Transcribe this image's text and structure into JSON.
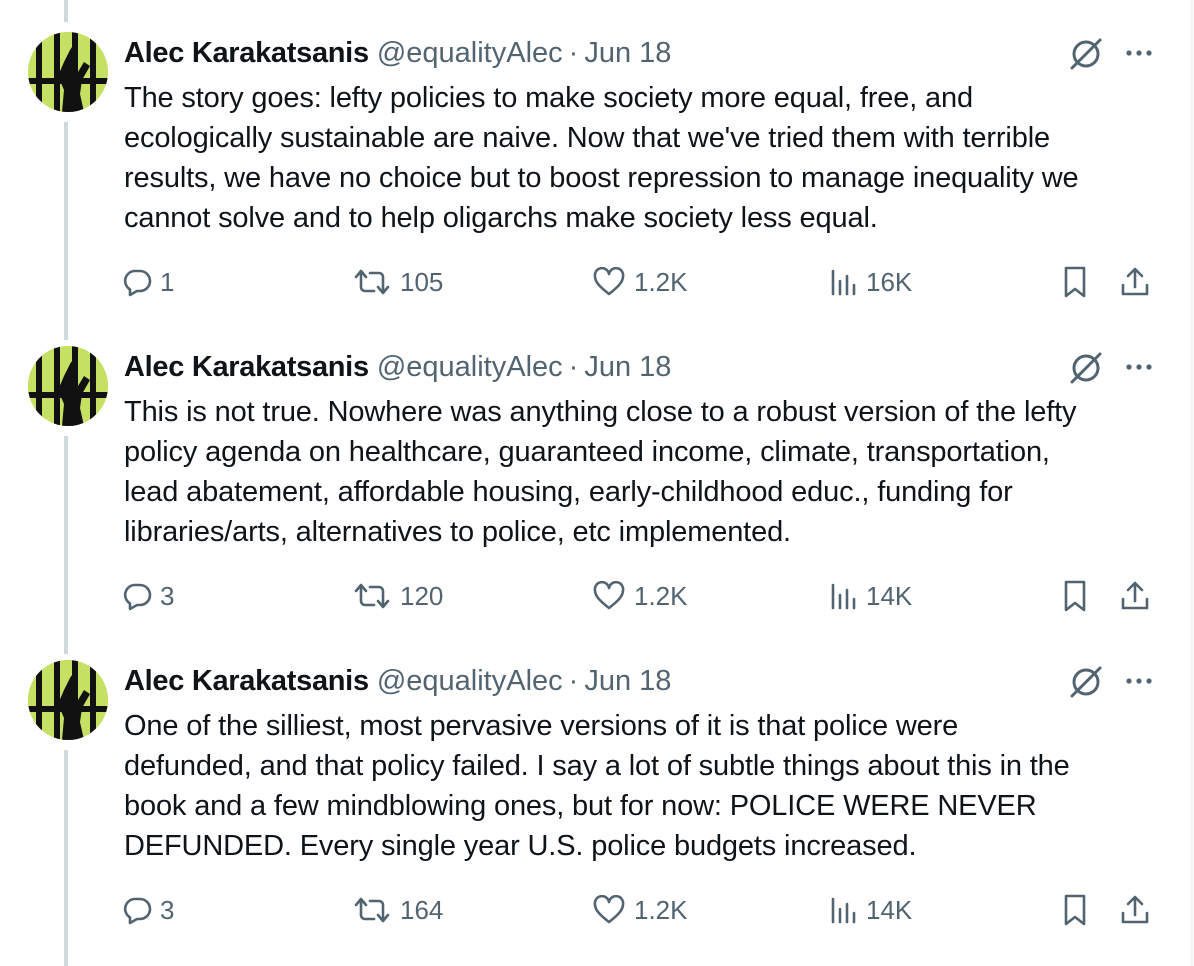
{
  "tweets": [
    {
      "author_name": "Alec Karakatsanis",
      "handle": "@equalityAlec",
      "separator": "·",
      "date": "Jun 18",
      "text_lines": [
        "The story goes: lefty policies to make society more equal, free, and",
        "ecologically sustainable are naive.  Now that we've tried them with terrible",
        "results, we have no choice but to boost repression to manage inequality we",
        "cannot solve and to help oligarchs make society less equal."
      ],
      "replies": "1",
      "reposts": "105",
      "likes": "1.2K",
      "views": "16K"
    },
    {
      "author_name": "Alec Karakatsanis",
      "handle": "@equalityAlec",
      "separator": "·",
      "date": "Jun 18",
      "text_lines": [
        "This is not true. Nowhere was anything close to a robust version of the lefty",
        "policy agenda on healthcare, guaranteed income, climate, transportation,",
        "lead abatement, affordable housing, early-childhood educ., funding for",
        "libraries/arts, alternatives to police, etc implemented."
      ],
      "replies": "3",
      "reposts": "120",
      "likes": "1.2K",
      "views": "14K"
    },
    {
      "author_name": "Alec Karakatsanis",
      "handle": "@equalityAlec",
      "separator": "·",
      "date": "Jun 18",
      "text_lines": [
        "One of the silliest, most pervasive versions of it is that police were",
        "defunded, and that policy failed. I say a lot of subtle things about this in the",
        "book and a few mindblowing ones, but for now: POLICE WERE NEVER",
        "DEFUNDED. Every single year U.S. police budgets increased."
      ],
      "replies": "3",
      "reposts": "164",
      "likes": "1.2K",
      "views": "14K"
    }
  ],
  "icons": {
    "reply": "reply-icon",
    "repost": "repost-icon",
    "like": "heart-icon",
    "views": "views-icon",
    "bookmark": "bookmark-icon",
    "share": "share-icon",
    "grok": "grok-icon",
    "more": "more-icon"
  },
  "colors": {
    "text": "#0f1419",
    "secondary": "#536471",
    "thread_line": "#cfd9de",
    "avatar_bg": "#c5e063"
  }
}
